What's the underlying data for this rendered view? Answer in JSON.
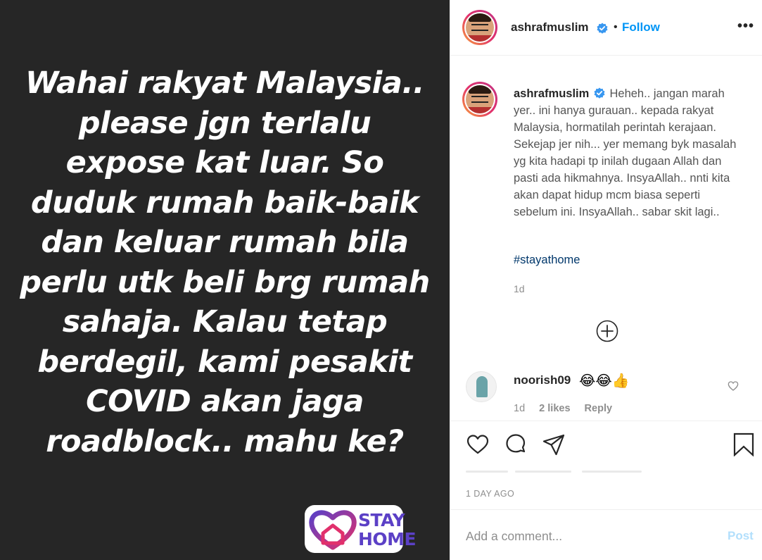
{
  "media": {
    "story_text": "Wahai rakyat Malaysia..\nplease jgn terlalu\nexpose kat luar. So\nduduk rumah baik-baik\ndan keluar rumah bila\nperlu utk beli brg rumah\nsahaja. Kalau tetap\nberdegil, kami pesakit\nCOVID akan jaga\nroadblock.. mahu ke?",
    "sticker_line1": "STAY",
    "sticker_line2": "HOME"
  },
  "header": {
    "username": "ashrafmuslim",
    "separator": "•",
    "follow_label": "Follow",
    "more_label": "•••"
  },
  "caption": {
    "username": "ashrafmuslim",
    "text": "Heheh.. jangan marah yer.. ini hanya gurauan.. kepada rakyat Malaysia, hormatilah perintah kerajaan. Sekejap jer nih... yer memang byk masalah yg kita hadapi tp inilah dugaan Allah dan pasti ada hikmahnya. InsyaAllah.. nnti kita akan dapat hidup mcm biasa seperti sebelum ini. InsyaAllah.. sabar skit lagi..",
    "hashtag": "#stayathome",
    "time": "1d"
  },
  "comment": {
    "username": "noorish09",
    "emoji": "😂😂👍",
    "time": "1d",
    "likes": "2 likes",
    "reply_label": "Reply"
  },
  "footer": {
    "time_ago": "1 DAY AGO",
    "comment_placeholder": "Add a comment...",
    "post_label": "Post"
  },
  "icons": {
    "verified": "verified-badge-icon",
    "load_more": "plus-circle-icon",
    "like": "heart-icon",
    "comment": "comment-bubble-icon",
    "share": "paper-plane-icon",
    "save": "bookmark-icon"
  },
  "colors": {
    "media_background": "#262626",
    "accent": "#0095f6",
    "verified": "#3897f0",
    "hashtag": "#00376b",
    "post_disabled": "#b2dffc",
    "sticker_purple": "#5b40c6",
    "sticker_pink": "#e1306c"
  }
}
